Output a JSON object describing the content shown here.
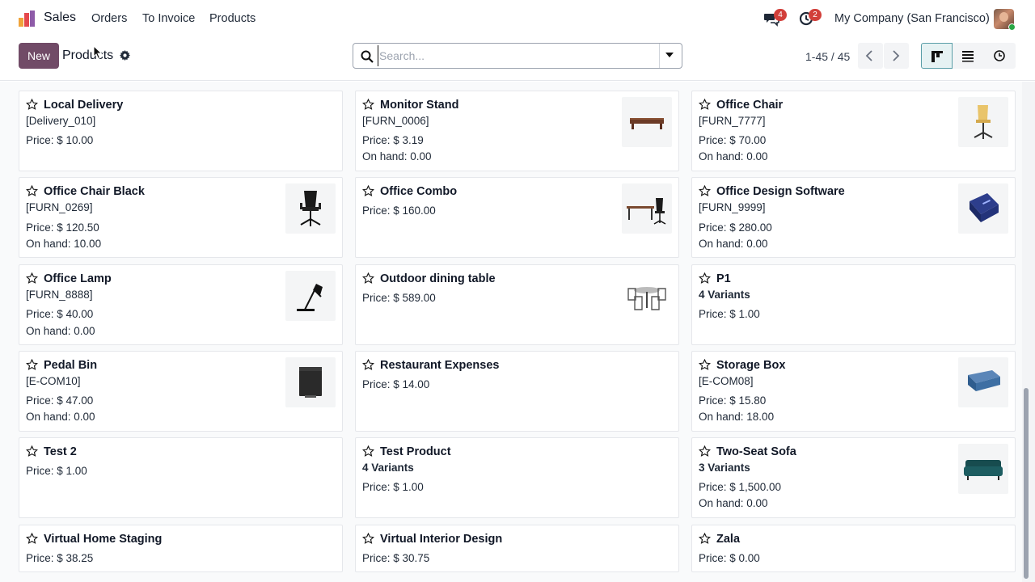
{
  "navbar": {
    "app_name": "Sales",
    "menu": [
      "Orders",
      "To Invoice",
      "Products"
    ],
    "messages_badge": "4",
    "activities_badge": "2",
    "company": "My Company (San Francisco)"
  },
  "control_panel": {
    "new_label": "New",
    "title": "Products",
    "search_placeholder": "Search...",
    "pager": "1-45 / 45"
  },
  "colors": {
    "brand": "#714b67",
    "badge": "#d23f3a",
    "active_view": "#5a9ea8"
  },
  "products": [
    {
      "name": "Local Delivery",
      "ref": "[Delivery_010]",
      "price": "Price: $ 10.00",
      "image": "none"
    },
    {
      "name": "Monitor Stand",
      "ref": "[FURN_0006]",
      "price": "Price: $ 3.19",
      "onhand": "On hand: 0.00",
      "image": "monitor-stand"
    },
    {
      "name": "Office Chair",
      "ref": "[FURN_7777]",
      "price": "Price: $ 70.00",
      "onhand": "On hand: 0.00",
      "image": "office-chair"
    },
    {
      "name": "Office Chair Black",
      "ref": "[FURN_0269]",
      "price": "Price: $ 120.50",
      "onhand": "On hand: 10.00",
      "image": "office-chair-black"
    },
    {
      "name": "Office Combo",
      "price": "Price: $ 160.00",
      "image": "office-combo"
    },
    {
      "name": "Office Design Software",
      "ref": "[FURN_9999]",
      "price": "Price: $ 280.00",
      "onhand": "On hand: 0.00",
      "image": "software-box"
    },
    {
      "name": "Office Lamp",
      "ref": "[FURN_8888]",
      "price": "Price: $ 40.00",
      "onhand": "On hand: 0.00",
      "image": "office-lamp"
    },
    {
      "name": "Outdoor dining table",
      "price": "Price: $ 589.00",
      "image": "dining-table"
    },
    {
      "name": "P1",
      "variants": "4 Variants",
      "price": "Price: $ 1.00",
      "image": "none"
    },
    {
      "name": "Pedal Bin",
      "ref": "[E-COM10]",
      "price": "Price: $ 47.00",
      "onhand": "On hand: 0.00",
      "image": "pedal-bin"
    },
    {
      "name": "Restaurant Expenses",
      "price": "Price: $ 14.00",
      "image": "none"
    },
    {
      "name": "Storage Box",
      "ref": "[E-COM08]",
      "price": "Price: $ 15.80",
      "onhand": "On hand: 18.00",
      "image": "storage-box"
    },
    {
      "name": "Test 2",
      "price": "Price: $ 1.00",
      "image": "none"
    },
    {
      "name": "Test Product",
      "variants": "4 Variants",
      "price": "Price: $ 1.00",
      "image": "none"
    },
    {
      "name": "Two-Seat Sofa",
      "variants": "3 Variants",
      "price": "Price: $ 1,500.00",
      "onhand": "On hand: 0.00",
      "image": "sofa"
    },
    {
      "name": "Virtual Home Staging",
      "price": "Price: $ 38.25",
      "image": "none"
    },
    {
      "name": "Virtual Interior Design",
      "price": "Price: $ 30.75",
      "image": "none"
    },
    {
      "name": "Zala",
      "price": "Price: $ 0.00",
      "image": "none"
    }
  ]
}
